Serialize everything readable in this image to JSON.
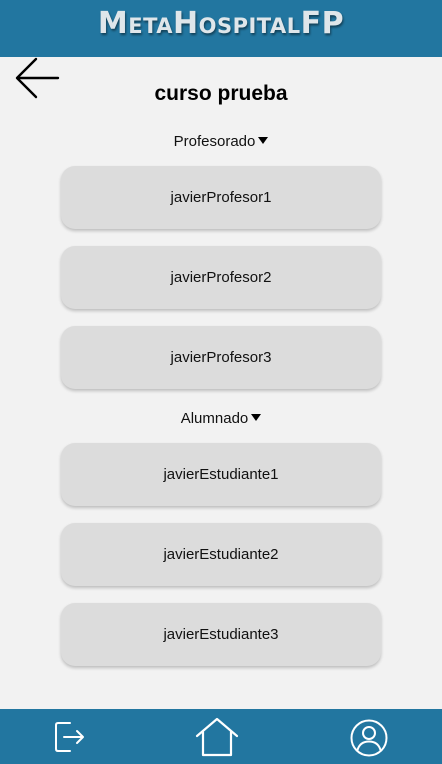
{
  "app": {
    "title": "MetaHospitalFP"
  },
  "page": {
    "title": "curso prueba"
  },
  "sections": {
    "teachers": {
      "label": "Profesorado",
      "items": [
        "javierProfesor1",
        "javierProfesor2",
        "javierProfesor3"
      ]
    },
    "students": {
      "label": "Alumnado",
      "items": [
        "javierEstudiante1",
        "javierEstudiante2",
        "javierEstudiante3"
      ]
    }
  },
  "icons": {
    "back": "arrow-left-icon",
    "logout": "logout-icon",
    "home": "home-icon",
    "profile": "user-circle-icon"
  },
  "colors": {
    "header_bg": "#2276a0",
    "page_bg": "#f2f2f2",
    "card_bg": "#dcdcdc"
  }
}
